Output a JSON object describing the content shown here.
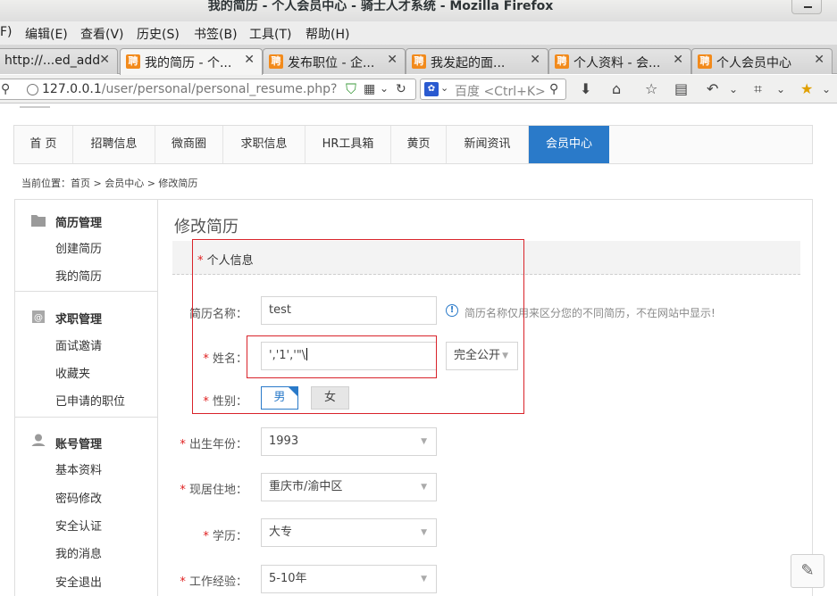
{
  "window": {
    "title": "我的简历 - 个人会员中心 - 骑士人才系统 - Mozilla Firefox"
  },
  "menu": [
    "F)",
    "编辑(E)",
    "查看(V)",
    "历史(S)",
    "书签(B)",
    "工具(T)",
    "帮助(H)"
  ],
  "tabs": [
    {
      "label": "http://...ed_add",
      "close": "✕"
    },
    {
      "label": "我的简历 - 个...",
      "close": "✕",
      "icon": "聘"
    },
    {
      "label": "发布职位 - 企...",
      "close": "✕",
      "icon": "聘"
    },
    {
      "label": "我发起的面...",
      "close": "✕",
      "icon": "聘"
    },
    {
      "label": "个人资料 - 会...",
      "close": "✕",
      "icon": "聘"
    },
    {
      "label": "个人会员中心",
      "close": "✕",
      "icon": "聘"
    }
  ],
  "address": {
    "host": "127.0.0.1",
    "path": "/user/personal/personal_resume.php?ac"
  },
  "search": {
    "placeholder": "百度 <Ctrl+K>"
  },
  "nav": [
    "首 页",
    "招聘信息",
    "微商圈",
    "求职信息",
    "HR工具箱",
    "黄页",
    "新闻资讯",
    "会员中心"
  ],
  "breadcrumb": "当前位置：首页 > 会员中心 > 修改简历",
  "sidebar": {
    "groups": [
      {
        "title": "简历管理",
        "icon": "folder-icon",
        "links": [
          "创建简历",
          "我的简历"
        ]
      },
      {
        "title": "求职管理",
        "icon": "at-icon",
        "links": [
          "面试邀请",
          "收藏夹",
          "已申请的职位"
        ]
      },
      {
        "title": "账号管理",
        "icon": "user-icon",
        "links": [
          "基本资料",
          "密码修改",
          "安全认证",
          "我的消息",
          "安全退出"
        ]
      }
    ]
  },
  "form": {
    "page_title": "修改简历",
    "section": "个人信息",
    "required_mark": "*",
    "resume_name": {
      "label": "简历名称：",
      "value": "test",
      "hint": "简历名称仅用来区分您的不同简历，不在网站中显示!"
    },
    "name": {
      "label": "姓名：",
      "value": "','1','\"\\",
      "privacy": "完全公开"
    },
    "gender": {
      "label": "性别：",
      "male": "男",
      "female": "女",
      "selected": "男"
    },
    "birth_year": {
      "label": "出生年份：",
      "value": "1993"
    },
    "residence": {
      "label": "现居住地：",
      "value": "重庆市/渝中区"
    },
    "education": {
      "label": "学历：",
      "value": "大专"
    },
    "experience": {
      "label": "工作经验：",
      "value": "5-10年"
    }
  },
  "colors": {
    "accent": "#2a7ac9",
    "highlight": "#d9232a",
    "favicon": "#f28a1b"
  }
}
